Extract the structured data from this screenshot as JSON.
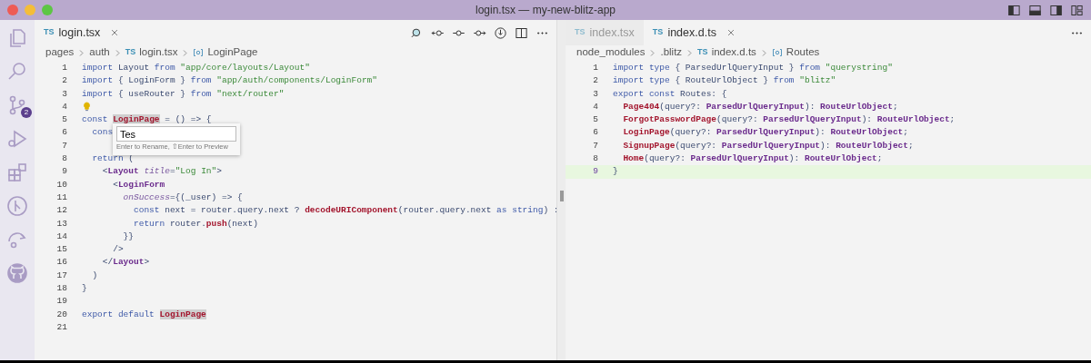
{
  "window": {
    "title": "login.tsx — my-new-blitz-app"
  },
  "activity_bar": [
    {
      "kind": "files"
    },
    {
      "kind": "search"
    },
    {
      "kind": "source-control",
      "badge": "2"
    },
    {
      "kind": "run"
    },
    {
      "kind": "extensions"
    },
    {
      "kind": "graph"
    },
    {
      "kind": "remote"
    },
    {
      "kind": "github"
    }
  ],
  "editors": [
    {
      "tabs": [
        {
          "lang": "TS",
          "label": "login.tsx",
          "selected": true
        }
      ],
      "toolbar": [
        {
          "kind": "search"
        },
        {
          "kind": "back"
        },
        {
          "kind": "commit"
        },
        {
          "kind": "forward"
        },
        {
          "kind": "timeline"
        },
        {
          "kind": "split"
        },
        {
          "kind": "more"
        }
      ],
      "breadcrumbs": [
        {
          "kind": "folder",
          "label": "pages"
        },
        {
          "kind": "folder",
          "label": "auth"
        },
        {
          "kind": "file",
          "lang": "TS",
          "label": "login.tsx"
        },
        {
          "kind": "symbol",
          "label": "LoginPage"
        }
      ],
      "rename": {
        "value": "Tes",
        "hint": "Enter to Rename, ⇧Enter to Preview"
      },
      "lines": [
        {
          "num": "1",
          "kind": "code",
          "current": false,
          "tokens": [
            {
              "kind": "keyword",
              "text": "import"
            },
            {
              "kind": "plain",
              "text": " Layout "
            },
            {
              "kind": "keyword",
              "text": "from "
            },
            {
              "kind": "string",
              "text": "\"app/core/layouts/Layout\""
            }
          ]
        },
        {
          "num": "2",
          "kind": "code",
          "current": false,
          "tokens": [
            {
              "kind": "keyword",
              "text": "import"
            },
            {
              "kind": "plain",
              "text": " { LoginForm } "
            },
            {
              "kind": "keyword",
              "text": "from "
            },
            {
              "kind": "string",
              "text": "\"app/auth/components/LoginForm\""
            }
          ]
        },
        {
          "num": "3",
          "kind": "code",
          "current": false,
          "tokens": [
            {
              "kind": "keyword",
              "text": "import"
            },
            {
              "kind": "plain",
              "text": " { useRouter } "
            },
            {
              "kind": "keyword",
              "text": "from "
            },
            {
              "kind": "string",
              "text": "\"next/router\""
            }
          ]
        },
        {
          "num": "4",
          "kind": "lightbulb",
          "current": false
        },
        {
          "num": "5",
          "kind": "code",
          "current": false,
          "tokens": [
            {
              "kind": "keyword",
              "text": "const "
            },
            {
              "kind": "highlight",
              "text": "LoginPage"
            },
            {
              "kind": "plain",
              "text": " = () => {"
            }
          ]
        },
        {
          "num": "6",
          "kind": "rename",
          "current": false,
          "tokens": [
            {
              "kind": "keyword",
              "text": "  cons"
            }
          ]
        },
        {
          "num": "7",
          "kind": "code",
          "current": false
        },
        {
          "num": "8",
          "kind": "code",
          "current": false,
          "tokens": [
            {
              "kind": "keyword",
              "text": "  return"
            },
            {
              "kind": "plain",
              "text": " ("
            }
          ]
        },
        {
          "num": "9",
          "kind": "code",
          "current": false,
          "tokens": [
            {
              "kind": "plain",
              "text": "    <"
            },
            {
              "kind": "tag",
              "text": "Layout"
            },
            {
              "kind": "attribute",
              "text": " title"
            },
            {
              "kind": "plain",
              "text": "="
            },
            {
              "kind": "string",
              "text": "\"Log In\""
            },
            {
              "kind": "plain",
              "text": ">"
            }
          ]
        },
        {
          "num": "10",
          "kind": "code",
          "current": false,
          "tokens": [
            {
              "kind": "plain",
              "text": "      <"
            },
            {
              "kind": "tag",
              "text": "LoginForm"
            }
          ]
        },
        {
          "num": "11",
          "kind": "code",
          "current": false,
          "tokens": [
            {
              "kind": "attribute",
              "text": "        onSuccess"
            },
            {
              "kind": "plain",
              "text": "={(_user) => {"
            }
          ]
        },
        {
          "num": "12",
          "kind": "code",
          "current": false,
          "tokens": [
            {
              "kind": "keyword",
              "text": "          const"
            },
            {
              "kind": "plain",
              "text": " next = router.query.next ? "
            },
            {
              "kind": "function",
              "text": "decodeURIComponent"
            },
            {
              "kind": "plain",
              "text": "(router.query.next "
            },
            {
              "kind": "keyword",
              "text": "as string"
            },
            {
              "kind": "plain",
              "text": ") :"
            }
          ]
        },
        {
          "num": "13",
          "kind": "code",
          "current": false,
          "tokens": [
            {
              "kind": "keyword",
              "text": "          return"
            },
            {
              "kind": "plain",
              "text": " router."
            },
            {
              "kind": "function",
              "text": "push"
            },
            {
              "kind": "plain",
              "text": "(next)"
            }
          ]
        },
        {
          "num": "14",
          "kind": "code",
          "current": false,
          "tokens": [
            {
              "kind": "plain",
              "text": "        }}"
            }
          ]
        },
        {
          "num": "15",
          "kind": "code",
          "current": false,
          "tokens": [
            {
              "kind": "plain",
              "text": "      />"
            }
          ]
        },
        {
          "num": "16",
          "kind": "code",
          "current": false,
          "tokens": [
            {
              "kind": "plain",
              "text": "    </"
            },
            {
              "kind": "tag",
              "text": "Layout"
            },
            {
              "kind": "plain",
              "text": ">"
            }
          ]
        },
        {
          "num": "17",
          "kind": "code",
          "current": false,
          "tokens": [
            {
              "kind": "plain",
              "text": "  )"
            }
          ]
        },
        {
          "num": "18",
          "kind": "code",
          "current": false,
          "tokens": [
            {
              "kind": "plain",
              "text": "}"
            }
          ]
        },
        {
          "num": "19",
          "kind": "code",
          "current": false
        },
        {
          "num": "20",
          "kind": "code",
          "current": false,
          "tokens": [
            {
              "kind": "keyword",
              "text": "export default "
            },
            {
              "kind": "highlight",
              "text": "LoginPage"
            }
          ]
        },
        {
          "num": "21",
          "kind": "code",
          "current": false
        }
      ]
    },
    {
      "tabs": [
        {
          "lang": "TS",
          "label": "index.tsx",
          "selected": false
        },
        {
          "lang": "TS",
          "label": "index.d.ts",
          "selected": true
        }
      ],
      "toolbar": [
        {
          "kind": "more"
        }
      ],
      "breadcrumbs": [
        {
          "kind": "folder",
          "label": "node_modules"
        },
        {
          "kind": "folder",
          "label": ".blitz"
        },
        {
          "kind": "file",
          "lang": "TS",
          "label": "index.d.ts"
        },
        {
          "kind": "symbol",
          "label": "Routes"
        }
      ],
      "lines": [
        {
          "num": "1",
          "kind": "code",
          "current": false,
          "tokens": [
            {
              "kind": "keyword",
              "text": "import type"
            },
            {
              "kind": "plain",
              "text": " { ParsedUrlQueryInput } "
            },
            {
              "kind": "keyword",
              "text": "from "
            },
            {
              "kind": "string",
              "text": "\"querystring\""
            }
          ]
        },
        {
          "num": "2",
          "kind": "code",
          "current": false,
          "tokens": [
            {
              "kind": "keyword",
              "text": "import type"
            },
            {
              "kind": "plain",
              "text": " { RouteUrlObject } "
            },
            {
              "kind": "keyword",
              "text": "from "
            },
            {
              "kind": "string",
              "text": "\"blitz\""
            }
          ]
        },
        {
          "num": "3",
          "kind": "code",
          "current": false,
          "tokens": [
            {
              "kind": "keyword",
              "text": "export const"
            },
            {
              "kind": "plain",
              "text": " Routes: {"
            }
          ]
        },
        {
          "num": "4",
          "kind": "code",
          "current": false,
          "tokens": [
            {
              "kind": "function",
              "text": "  Page404"
            },
            {
              "kind": "plain",
              "text": "(query?: "
            },
            {
              "kind": "type",
              "text": "ParsedUrlQueryInput"
            },
            {
              "kind": "plain",
              "text": "): "
            },
            {
              "kind": "type",
              "text": "RouteUrlObject"
            },
            {
              "kind": "plain",
              "text": ";"
            }
          ]
        },
        {
          "num": "5",
          "kind": "code",
          "current": false,
          "tokens": [
            {
              "kind": "function",
              "text": "  ForgotPasswordPage"
            },
            {
              "kind": "plain",
              "text": "(query?: "
            },
            {
              "kind": "type",
              "text": "ParsedUrlQueryInput"
            },
            {
              "kind": "plain",
              "text": "): "
            },
            {
              "kind": "type",
              "text": "RouteUrlObject"
            },
            {
              "kind": "plain",
              "text": ";"
            }
          ]
        },
        {
          "num": "6",
          "kind": "code",
          "current": false,
          "tokens": [
            {
              "kind": "function",
              "text": "  LoginPage"
            },
            {
              "kind": "plain",
              "text": "(query?: "
            },
            {
              "kind": "type",
              "text": "ParsedUrlQueryInput"
            },
            {
              "kind": "plain",
              "text": "): "
            },
            {
              "kind": "type",
              "text": "RouteUrlObject"
            },
            {
              "kind": "plain",
              "text": ";"
            }
          ]
        },
        {
          "num": "7",
          "kind": "code",
          "current": false,
          "tokens": [
            {
              "kind": "function",
              "text": "  SignupPage"
            },
            {
              "kind": "plain",
              "text": "(query?: "
            },
            {
              "kind": "type",
              "text": "ParsedUrlQueryInput"
            },
            {
              "kind": "plain",
              "text": "): "
            },
            {
              "kind": "type",
              "text": "RouteUrlObject"
            },
            {
              "kind": "plain",
              "text": ";"
            }
          ]
        },
        {
          "num": "8",
          "kind": "code",
          "current": false,
          "tokens": [
            {
              "kind": "function",
              "text": "  Home"
            },
            {
              "kind": "plain",
              "text": "(query?: "
            },
            {
              "kind": "type",
              "text": "ParsedUrlQueryInput"
            },
            {
              "kind": "plain",
              "text": "): "
            },
            {
              "kind": "type",
              "text": "RouteUrlObject"
            },
            {
              "kind": "plain",
              "text": ";"
            }
          ]
        },
        {
          "num": "9",
          "kind": "code",
          "current": true,
          "tokens": [
            {
              "kind": "plain",
              "text": "}"
            }
          ]
        }
      ]
    }
  ]
}
